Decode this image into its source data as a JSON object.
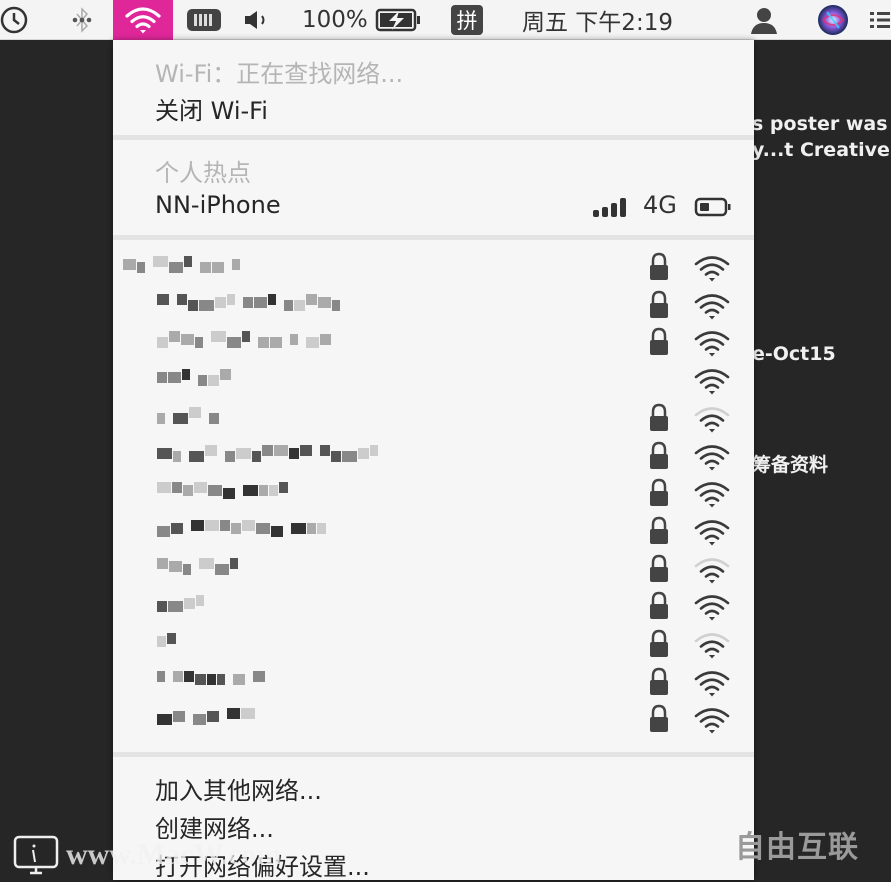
{
  "menubar": {
    "items": [
      {
        "name": "time-machine-icon"
      },
      {
        "name": "bluetooth-icon"
      },
      {
        "name": "wifi-icon",
        "active": true
      },
      {
        "name": "battery-widget-icon"
      },
      {
        "name": "volume-icon"
      }
    ],
    "battery_percent": "100%",
    "input_method": "拼",
    "clock": "周五 下午2:19",
    "accent_color": "#e0279a"
  },
  "background": {
    "texts": [
      "s poster was",
      "y...t Creative.n",
      "e-Oct15",
      "筹备资料"
    ]
  },
  "wifi_menu": {
    "status": "Wi-Fi：正在查找网络...",
    "toggle_label": "关闭 Wi-Fi",
    "hotspot_header": "个人热点",
    "hotspot": {
      "name": "NN-iPhone",
      "network_type": "4G",
      "signal_bars": 4,
      "battery_level": 0.3
    },
    "networks": [
      {
        "name": "[redacted]",
        "locked": true,
        "strength": 3
      },
      {
        "name": "[redacted]",
        "locked": true,
        "strength": 3
      },
      {
        "name": "[redacted]",
        "locked": true,
        "strength": 3
      },
      {
        "name": "[redacted]",
        "locked": false,
        "strength": 3
      },
      {
        "name": "[redacted]",
        "locked": true,
        "strength": 2
      },
      {
        "name": "[redacted]",
        "locked": true,
        "strength": 3
      },
      {
        "name": "[redacted]",
        "locked": true,
        "strength": 3
      },
      {
        "name": "[redacted]",
        "locked": true,
        "strength": 3
      },
      {
        "name": "[redacted]",
        "locked": true,
        "strength": 2
      },
      {
        "name": "[redacted]",
        "locked": true,
        "strength": 3
      },
      {
        "name": "[redacted]",
        "locked": true,
        "strength": 2
      },
      {
        "name": "[redacted]",
        "locked": true,
        "strength": 3
      },
      {
        "name": "[redacted]",
        "locked": true,
        "strength": 3
      }
    ],
    "actions": [
      "加入其他网络...",
      "创建网络...",
      "打开网络偏好设置..."
    ]
  },
  "watermarks": {
    "left": "www.MacW.com",
    "right": "自由互联"
  }
}
